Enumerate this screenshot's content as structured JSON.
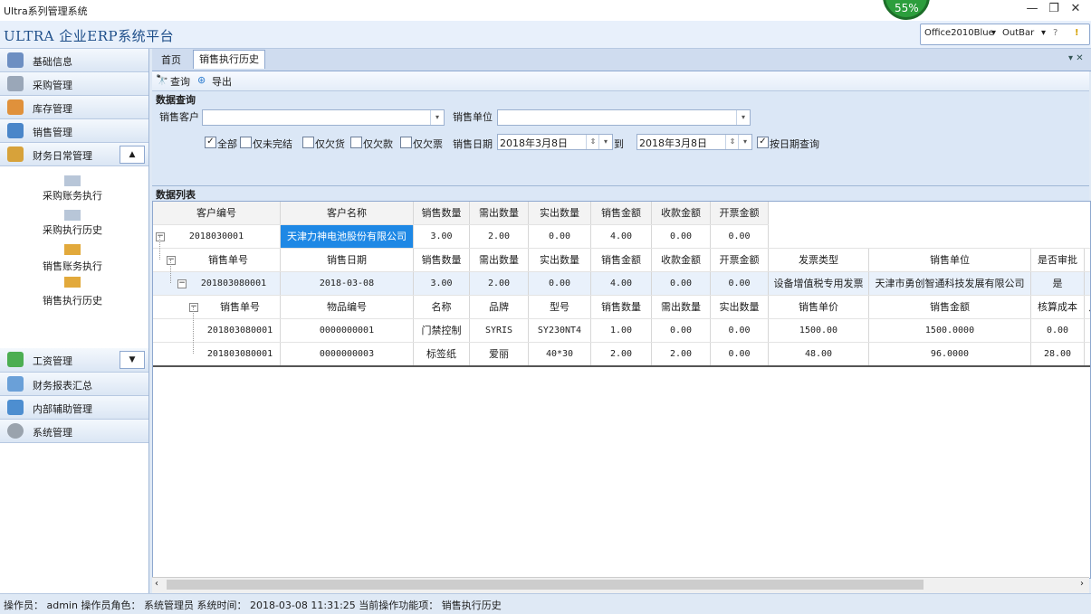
{
  "window": {
    "title": "Ultra系列管理系统",
    "perf_badge": "55%"
  },
  "header": {
    "brand": "ULTRA  企业ERP系统平台",
    "theme": "Office2010Blue",
    "outbar": "OutBar"
  },
  "sidebar": {
    "items": [
      {
        "label": "基础信息"
      },
      {
        "label": "采购管理"
      },
      {
        "label": "库存管理"
      },
      {
        "label": "销售管理"
      },
      {
        "label": "财务日常管理"
      }
    ],
    "sub_items": [
      "采购账务执行",
      "采购执行历史",
      "销售账务执行",
      "销售执行历史"
    ],
    "bottom_items": [
      {
        "label": "工资管理"
      },
      {
        "label": "财务报表汇总"
      },
      {
        "label": "内部辅助管理"
      },
      {
        "label": "系统管理"
      }
    ]
  },
  "tabs": [
    {
      "label": "首页"
    },
    {
      "label": "销售执行历史"
    }
  ],
  "toolbar": {
    "query_label": "查询",
    "export_label": "导出"
  },
  "query_panel": {
    "title": "数据查询",
    "customer_label": "销售客户",
    "customer_value": "",
    "unit_label": "销售单位",
    "unit_value": "",
    "filters": [
      {
        "label": "全部",
        "checked": true
      },
      {
        "label": "仅未完结",
        "checked": false
      },
      {
        "label": "仅欠货",
        "checked": false
      },
      {
        "label": "仅欠款",
        "checked": false
      },
      {
        "label": "仅欠票",
        "checked": false
      }
    ],
    "date_label": "销售日期",
    "date_from": "2018年3月8日",
    "date_to_label": "到",
    "date_to": "2018年3月8日",
    "by_date_label": "按日期查询",
    "by_date_checked": true
  },
  "list": {
    "title": "数据列表",
    "level1_headers": [
      "客户编号",
      "客户名称",
      "销售数量",
      "需出数量",
      "实出数量",
      "销售金额",
      "收款金额",
      "开票金额"
    ],
    "level1_row": [
      "2018030001",
      "天津力神电池股份有限公司",
      "3.00",
      "2.00",
      "0.00",
      "4.00",
      "0.00",
      "0.00"
    ],
    "level2_headers": [
      "销售单号",
      "销售日期",
      "销售数量",
      "需出数量",
      "实出数量",
      "销售金额",
      "收款金额",
      "开票金额",
      "发票类型",
      "销售单位",
      "是否审批"
    ],
    "level2_row": [
      "201803080001",
      "2018-03-08",
      "3.00",
      "2.00",
      "0.00",
      "4.00",
      "0.00",
      "0.00",
      "设备增值税专用发票",
      "天津市勇创智通科技发展有限公司",
      "是"
    ],
    "level3_headers": [
      "销售单号",
      "物品编号",
      "名称",
      "品牌",
      "型号",
      "销售数量",
      "需出数量",
      "实出数量",
      "销售单价",
      "销售金额",
      "核算成本",
      "月"
    ],
    "level3_rows": [
      [
        "201803080001",
        "0000000001",
        "门禁控制",
        "SYRIS",
        "SY230NT4",
        "1.00",
        "0.00",
        "0.00",
        "1500.00",
        "1500.0000",
        "0.00"
      ],
      [
        "201803080001",
        "0000000003",
        "标签纸",
        "爱丽",
        "40*30",
        "2.00",
        "2.00",
        "0.00",
        "48.00",
        "96.0000",
        "28.00"
      ]
    ]
  },
  "status": {
    "text": "操作员： admin  操作员角色： 系统管理员  系统时间： 2018-03-08 11:31:25  当前操作功能项： 销售执行历史"
  },
  "colors": {
    "accent": "#1f4f8a",
    "selection": "#1e88e5",
    "panel": "#dbe7f6"
  }
}
